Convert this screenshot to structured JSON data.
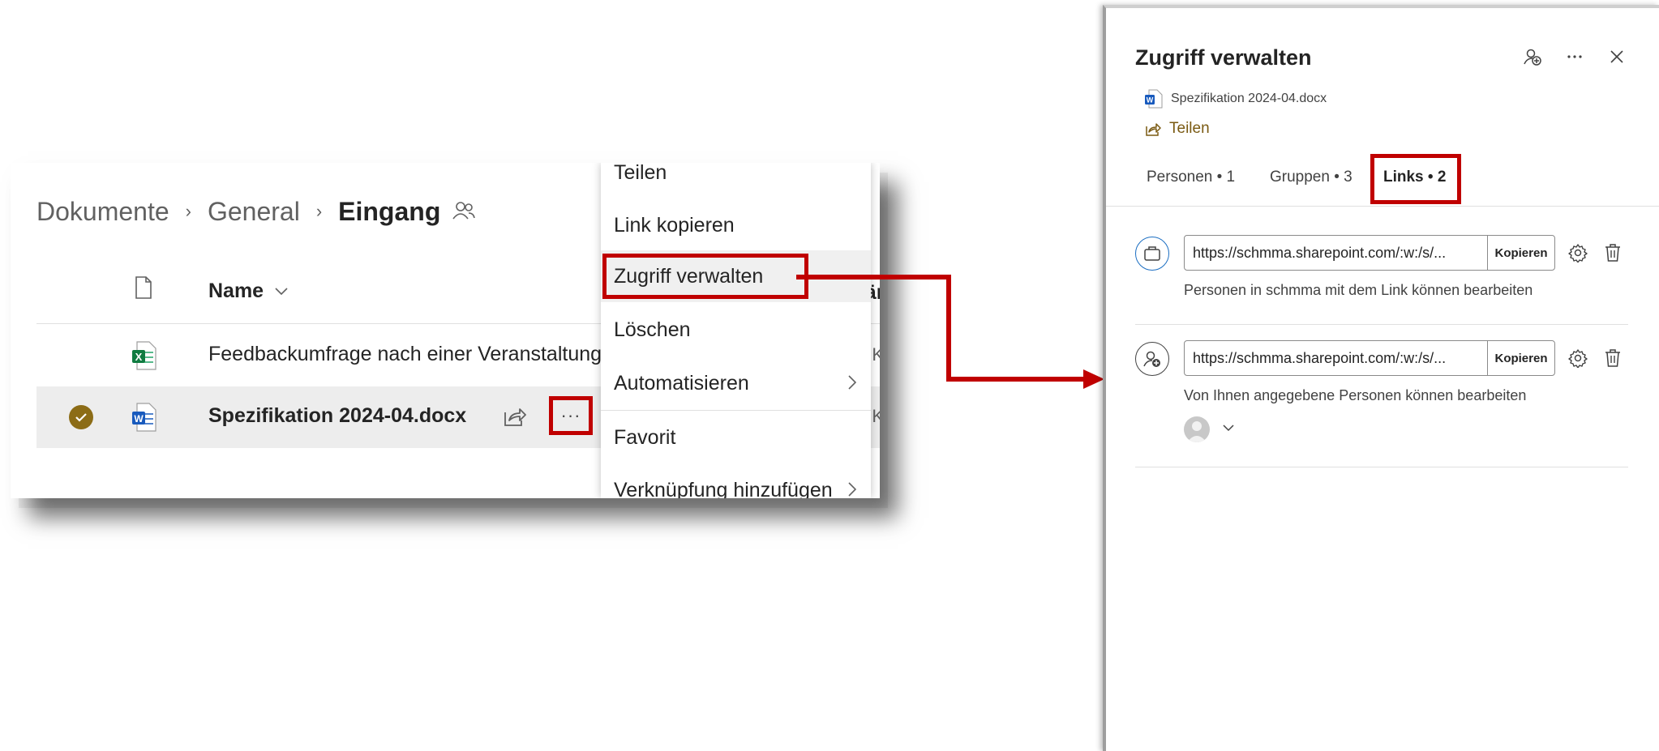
{
  "library": {
    "breadcrumb": [
      "Dokumente",
      "General",
      "Eingang"
    ],
    "header_name": "Name",
    "header_modified_partial": "eär",
    "files": [
      {
        "name": "Feedbackumfrage nach einer Veranstaltung...",
        "type": "excel",
        "modified_by_partial": "rl K"
      },
      {
        "name": "Spezifikation 2024-04.docx",
        "type": "word",
        "modified_by_partial": "rl K",
        "selected": true
      }
    ],
    "more_label": "···"
  },
  "context_menu": {
    "items": [
      "Teilen",
      "Link kopieren",
      "Zugriff verwalten",
      "Löschen",
      "Automatisieren",
      "Favorit",
      "Verknüpfung hinzufügen"
    ]
  },
  "panel": {
    "title": "Zugriff verwalten",
    "document": "Spezifikation 2024-04.docx",
    "share_label": "Teilen",
    "tabs": [
      "Personen • 1",
      "Gruppen • 3",
      "Links • 2"
    ],
    "links": [
      {
        "url": "https://schmma.sharepoint.com/:w:/s/...",
        "copy_label": "Kopieren",
        "description": "Personen in schmma mit dem Link können bearbeiten"
      },
      {
        "url": "https://schmma.sharepoint.com/:w:/s/...",
        "copy_label": "Kopieren",
        "description": "Von Ihnen angegebene Personen können bearbeiten"
      }
    ]
  },
  "colors": {
    "highlight": "#c00000",
    "accent": "#8c6c16"
  }
}
